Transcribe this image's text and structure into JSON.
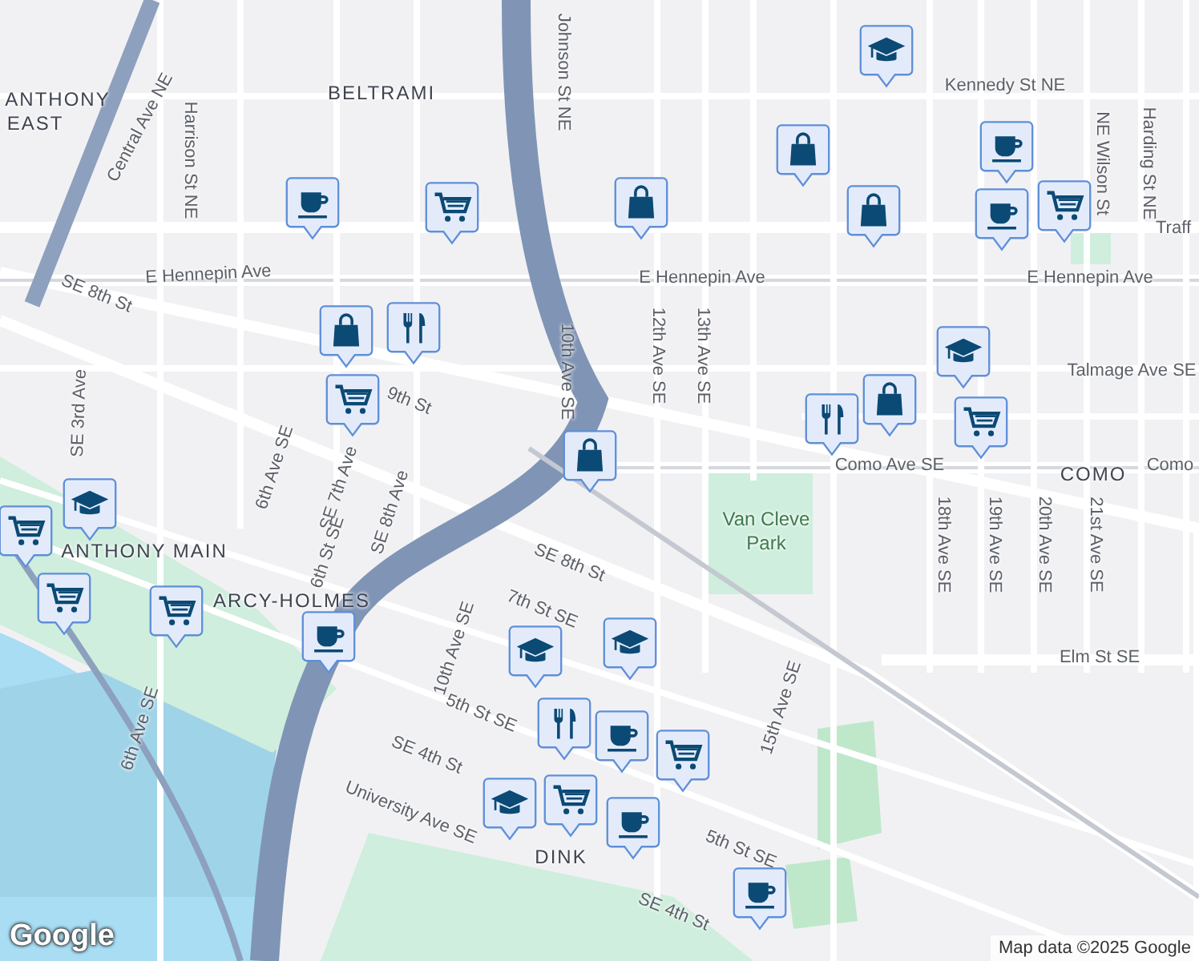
{
  "map": {
    "labels": [
      {
        "text": "BELTRAMI",
        "kind": "district"
      },
      {
        "text": "ANTHONY",
        "kind": "district"
      },
      {
        "text": "EAST",
        "kind": "district"
      },
      {
        "text": "Kennedy St NE",
        "kind": "street"
      },
      {
        "text": "E Hennepin Ave",
        "kind": "street"
      },
      {
        "text": "E Hennepin Ave",
        "kind": "street"
      },
      {
        "text": "E Hennepin Ave",
        "kind": "street"
      },
      {
        "text": "SE 8th St",
        "kind": "street"
      },
      {
        "text": "Como Ave SE",
        "kind": "street"
      },
      {
        "text": "COMO",
        "kind": "district"
      },
      {
        "text": "Como",
        "kind": "street"
      },
      {
        "text": "Van Cleve",
        "kind": "park"
      },
      {
        "text": "Park",
        "kind": "park"
      },
      {
        "text": "Talmage Ave SE",
        "kind": "street"
      },
      {
        "text": "Elm St SE",
        "kind": "street"
      },
      {
        "text": "Johnson St NE",
        "kind": "street"
      },
      {
        "text": "10th Ave SE",
        "kind": "street"
      },
      {
        "text": "12th Ave SE",
        "kind": "street"
      },
      {
        "text": "13th Ave SE",
        "kind": "street"
      },
      {
        "text": "15th Ave SE",
        "kind": "street"
      },
      {
        "text": "18th Ave SE",
        "kind": "street"
      },
      {
        "text": "19th Ave SE",
        "kind": "street"
      },
      {
        "text": "20th Ave SE",
        "kind": "street"
      },
      {
        "text": "21st Ave SE",
        "kind": "street"
      },
      {
        "text": "NE Wilson St",
        "kind": "street"
      },
      {
        "text": "Harding St NE",
        "kind": "street"
      },
      {
        "text": "Central Ave NE",
        "kind": "street"
      },
      {
        "text": "Harrison St NE",
        "kind": "street"
      },
      {
        "text": "ANTHONY MAIN",
        "kind": "district"
      },
      {
        "text": "ARCY-HOLMES",
        "kind": "district"
      },
      {
        "text": "SE 3rd Ave",
        "kind": "street"
      },
      {
        "text": "6th Ave SE",
        "kind": "street"
      },
      {
        "text": "SE 7th Ave",
        "kind": "street"
      },
      {
        "text": "6th St SE",
        "kind": "street"
      },
      {
        "text": "SE 8th Ave",
        "kind": "street"
      },
      {
        "text": "SE 8th St",
        "kind": "street"
      },
      {
        "text": "7th St SE",
        "kind": "street"
      },
      {
        "text": "5th St SE",
        "kind": "street"
      },
      {
        "text": "SE 4th St",
        "kind": "street"
      },
      {
        "text": "University Ave SE",
        "kind": "street"
      },
      {
        "text": "10th Ave SE",
        "kind": "street"
      },
      {
        "text": "5th St SE",
        "kind": "street"
      },
      {
        "text": "SE 4th St",
        "kind": "street"
      },
      {
        "text": "6th Ave SE",
        "kind": "street"
      },
      {
        "text": "DINK",
        "kind": "district"
      },
      {
        "text": "9th St",
        "kind": "street"
      },
      {
        "text": "Traff",
        "kind": "street"
      }
    ],
    "pins": [
      {
        "kind": "cap"
      },
      {
        "kind": "bag"
      },
      {
        "kind": "cup"
      },
      {
        "kind": "bag"
      },
      {
        "kind": "cup"
      },
      {
        "kind": "cart"
      },
      {
        "kind": "cup"
      },
      {
        "kind": "cart"
      },
      {
        "kind": "bag"
      },
      {
        "kind": "bag"
      },
      {
        "kind": "fork"
      },
      {
        "kind": "cart"
      },
      {
        "kind": "cap"
      },
      {
        "kind": "fork"
      },
      {
        "kind": "bag"
      },
      {
        "kind": "cart"
      },
      {
        "kind": "bag"
      },
      {
        "kind": "cap"
      },
      {
        "kind": "cart"
      },
      {
        "kind": "cart"
      },
      {
        "kind": "cart"
      },
      {
        "kind": "cup"
      },
      {
        "kind": "cap"
      },
      {
        "kind": "cap"
      },
      {
        "kind": "fork"
      },
      {
        "kind": "cup"
      },
      {
        "kind": "cart"
      },
      {
        "kind": "cap"
      },
      {
        "kind": "cart"
      },
      {
        "kind": "cup"
      },
      {
        "kind": "cup"
      }
    ]
  },
  "logo": "Google",
  "attribution": "Map data ©2025 Google"
}
